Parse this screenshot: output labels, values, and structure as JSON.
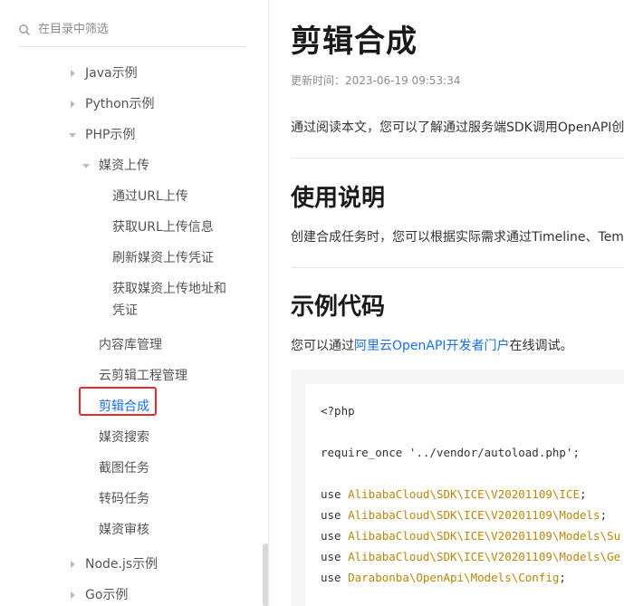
{
  "sidebar": {
    "search_placeholder": "在目录中筛选",
    "items": [
      {
        "label": "Java示例",
        "level": 1,
        "expanded": false
      },
      {
        "label": "Python示例",
        "level": 1,
        "expanded": false
      },
      {
        "label": "PHP示例",
        "level": 1,
        "expanded": true
      },
      {
        "label": "媒资上传",
        "level": 2,
        "expanded": true
      },
      {
        "label": "通过URL上传",
        "level": 3
      },
      {
        "label": "获取URL上传信息",
        "level": 3
      },
      {
        "label": "刷新媒资上传凭证",
        "level": 3
      },
      {
        "label": "获取媒资上传地址和",
        "label_line2": "凭证",
        "level": 3
      },
      {
        "label": "内容库管理",
        "level": 2
      },
      {
        "label": "云剪辑工程管理",
        "level": 2
      },
      {
        "label": "剪辑合成",
        "level": 2,
        "active": true
      },
      {
        "label": "媒资搜索",
        "level": 2
      },
      {
        "label": "截图任务",
        "level": 2
      },
      {
        "label": "转码任务",
        "level": 2
      },
      {
        "label": "媒资审核",
        "level": 2
      },
      {
        "label": "Node.js示例",
        "level": 1,
        "expanded": false
      },
      {
        "label": "Go示例",
        "level": 1,
        "expanded": false
      }
    ]
  },
  "content": {
    "title": "剪辑合成",
    "updated": "更新时间：2023-06-19 09:53:34",
    "intro": "通过阅读本文，您可以了解通过服务端SDK调用OpenAPI创",
    "section1_title": "使用说明",
    "section1_text": "创建合成任务时，您可以根据实际需求通过Timeline、Tem",
    "section2_title": "示例代码",
    "section2_pre": "您可以通过",
    "section2_link": "阿里云OpenAPI开发者门户",
    "section2_post": "在线调试。",
    "code_lines": {
      "l1": "<?php",
      "l2": "require_once '../vendor/autoload.php';",
      "use": "use",
      "u1": "AlibabaCloud\\SDK\\ICE\\V20201109\\ICE",
      "u2": "AlibabaCloud\\SDK\\ICE\\V20201109\\Models",
      "u3": "AlibabaCloud\\SDK\\ICE\\V20201109\\Models\\Su",
      "u4": "AlibabaCloud\\SDK\\ICE\\V20201109\\Models\\Ge",
      "u5": "Darabonba\\OpenApi\\Models\\Config",
      "semi": ";"
    }
  },
  "colors": {
    "accent": "#1a6fe0",
    "highlight_border": "#e42b2b",
    "namespace": "#b8860b"
  }
}
